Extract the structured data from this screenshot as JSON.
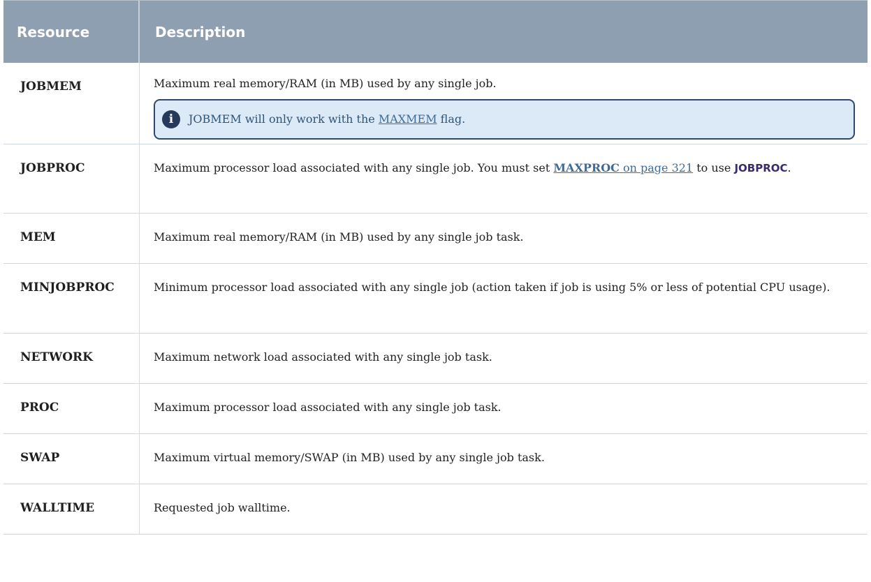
{
  "header": {
    "col1": "Resource",
    "col2": "Description"
  },
  "rows": [
    {
      "name": "JOBMEM",
      "desc": "Maximum real memory/RAM (in MB) used by any single job.",
      "note": {
        "pre": "JOBMEM will only work with the ",
        "link": "MAXMEM",
        "post": " flag."
      }
    },
    {
      "name": "JOBPROC",
      "desc_pre": "Maximum processor load associated with any single job. You must set ",
      "link_bold": "MAXPROC",
      "link_rest": " on page 321",
      "desc_mid": " to use ",
      "keyword": "JOBPROC",
      "desc_post": "."
    },
    {
      "name": "MEM",
      "desc": "Maximum real memory/RAM (in MB) used by any single job task."
    },
    {
      "name": "MINJOBPROC",
      "desc": "Minimum processor load associated with any single job (action taken if job is using 5% or less of potential CPU usage)."
    },
    {
      "name": "NETWORK",
      "desc": "Maximum network load associated with any single job task."
    },
    {
      "name": "PROC",
      "desc": "Maximum processor load associated with any single job task."
    },
    {
      "name": "SWAP",
      "desc": "Maximum virtual memory/SWAP (in MB) used by any single job task."
    },
    {
      "name": "WALLTIME",
      "desc": "Requested job walltime."
    }
  ],
  "note_icon": "info-icon",
  "colors": {
    "header_bg": "#8e9fb2",
    "note_bg": "#dce9f7",
    "link": "#3e6c96"
  }
}
